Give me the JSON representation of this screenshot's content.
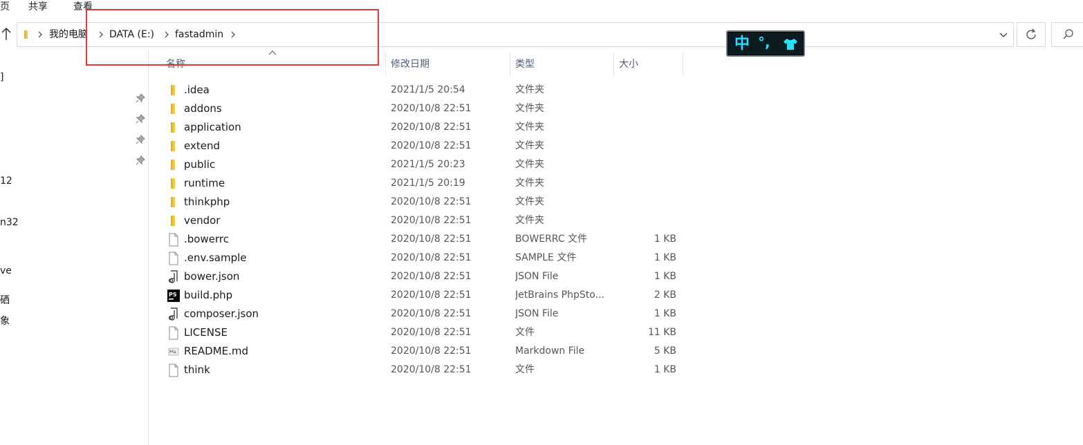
{
  "ribbon": {
    "tabs": [
      "页",
      "共享",
      "查看"
    ]
  },
  "address_bar": {
    "crumbs": [
      "我的电脑",
      "DATA (E:)",
      "fastadmin"
    ]
  },
  "ime": {
    "mode": "中",
    "punct": "°,",
    "skin_icon": "shirt-icon"
  },
  "nav_pane": {
    "fragments": [
      "]",
      "12",
      "n32",
      "ve",
      "硒",
      "象"
    ]
  },
  "columns": {
    "name": "名称",
    "modified": "修改日期",
    "type": "类型",
    "size": "大小"
  },
  "files": [
    {
      "name": ".idea",
      "modified": "2021/1/5 20:54",
      "type": "文件夹",
      "size": "",
      "icon": "folder-icon"
    },
    {
      "name": "addons",
      "modified": "2020/10/8 22:51",
      "type": "文件夹",
      "size": "",
      "icon": "folder-icon"
    },
    {
      "name": "application",
      "modified": "2020/10/8 22:51",
      "type": "文件夹",
      "size": "",
      "icon": "folder-icon"
    },
    {
      "name": "extend",
      "modified": "2020/10/8 22:51",
      "type": "文件夹",
      "size": "",
      "icon": "folder-icon"
    },
    {
      "name": "public",
      "modified": "2021/1/5 20:23",
      "type": "文件夹",
      "size": "",
      "icon": "folder-icon"
    },
    {
      "name": "runtime",
      "modified": "2021/1/5 20:19",
      "type": "文件夹",
      "size": "",
      "icon": "folder-icon"
    },
    {
      "name": "thinkphp",
      "modified": "2020/10/8 22:51",
      "type": "文件夹",
      "size": "",
      "icon": "folder-icon"
    },
    {
      "name": "vendor",
      "modified": "2020/10/8 22:51",
      "type": "文件夹",
      "size": "",
      "icon": "folder-icon"
    },
    {
      "name": ".bowerrc",
      "modified": "2020/10/8 22:51",
      "type": "BOWERRC 文件",
      "size": "1 KB",
      "icon": "file-icon"
    },
    {
      "name": ".env.sample",
      "modified": "2020/10/8 22:51",
      "type": "SAMPLE 文件",
      "size": "1 KB",
      "icon": "file-icon"
    },
    {
      "name": "bower.json",
      "modified": "2020/10/8 22:51",
      "type": "JSON File",
      "size": "1 KB",
      "icon": "json-file-icon"
    },
    {
      "name": "build.php",
      "modified": "2020/10/8 22:51",
      "type": "JetBrains PhpSto...",
      "size": "2 KB",
      "icon": "phpstorm-file-icon"
    },
    {
      "name": "composer.json",
      "modified": "2020/10/8 22:51",
      "type": "JSON File",
      "size": "1 KB",
      "icon": "json-file-icon"
    },
    {
      "name": "LICENSE",
      "modified": "2020/10/8 22:51",
      "type": "文件",
      "size": "11 KB",
      "icon": "file-icon"
    },
    {
      "name": "README.md",
      "modified": "2020/10/8 22:51",
      "type": "Markdown File",
      "size": "5 KB",
      "icon": "markdown-file-icon"
    },
    {
      "name": "think",
      "modified": "2020/10/8 22:51",
      "type": "文件",
      "size": "1 KB",
      "icon": "file-icon"
    }
  ],
  "colors": {
    "highlight": "#e53935",
    "ime_text": "#21e3ff",
    "folder": "#f5c93a"
  }
}
